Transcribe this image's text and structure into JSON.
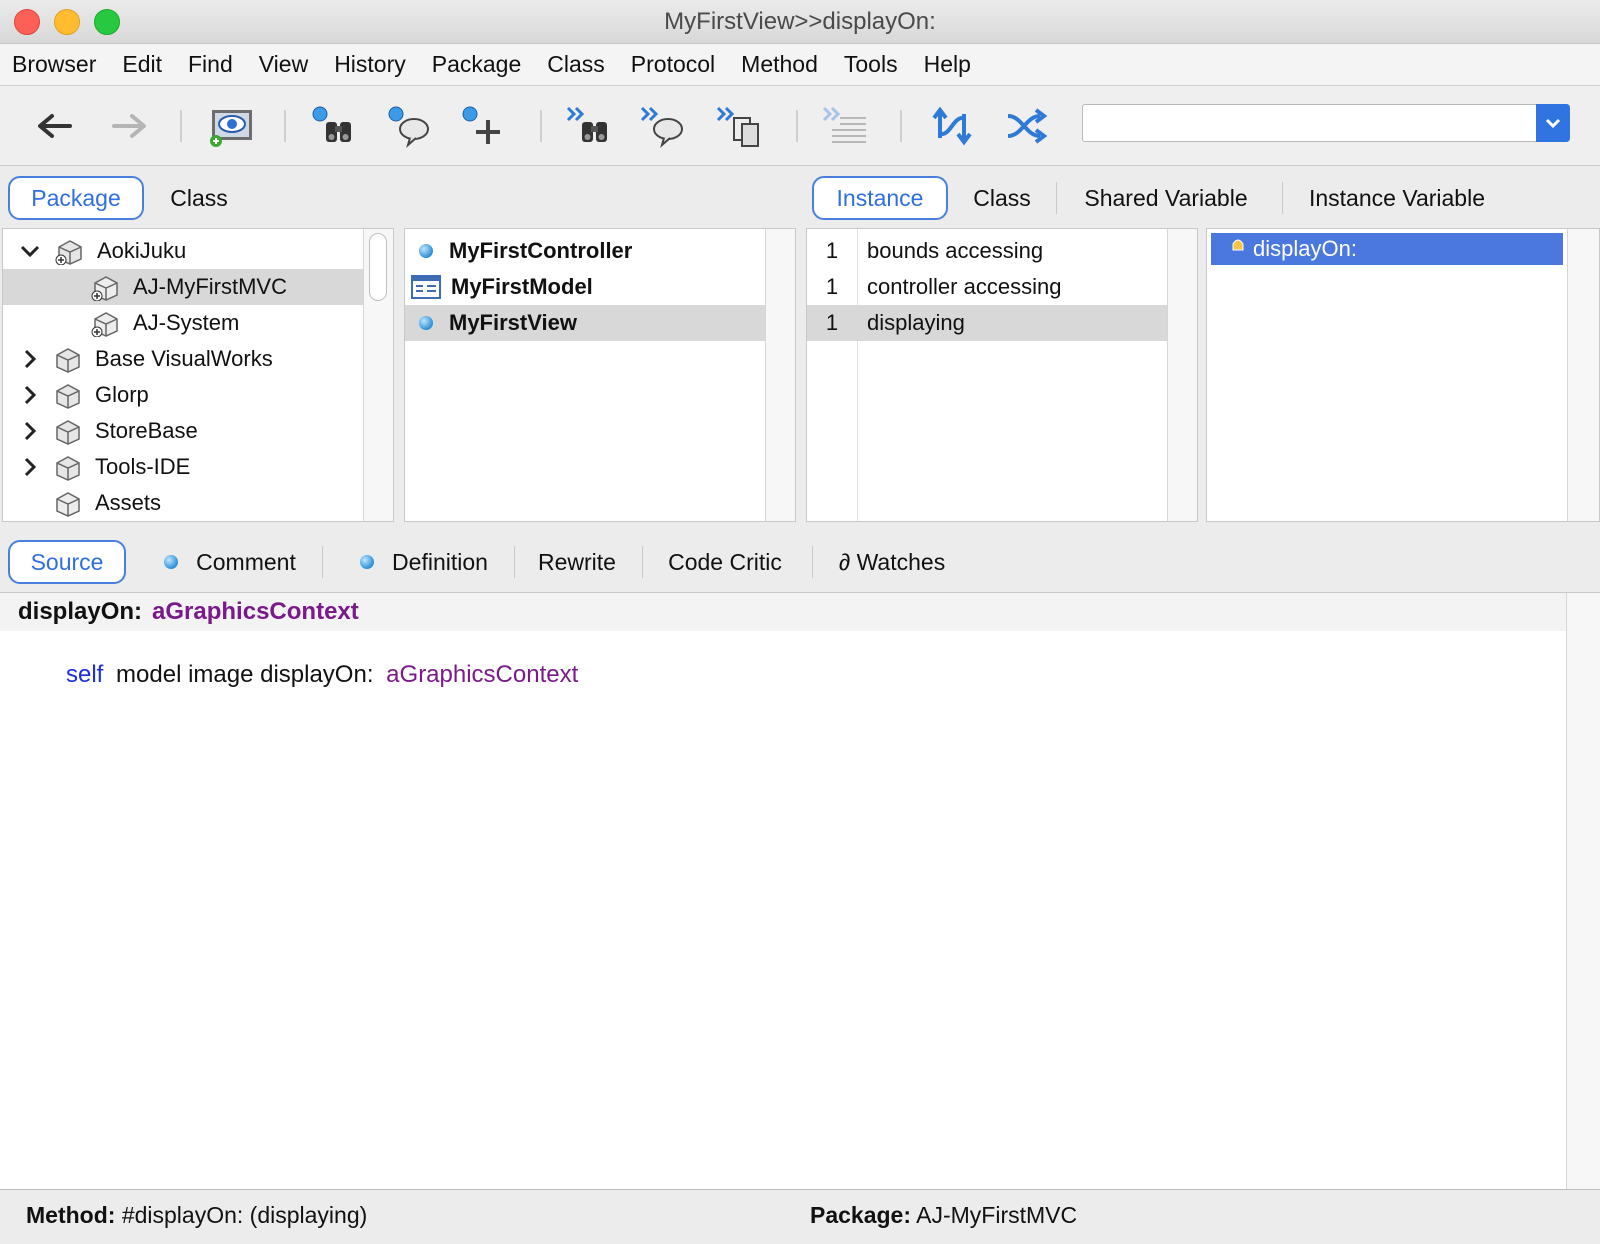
{
  "window": {
    "title": "MyFirstView>>displayOn:"
  },
  "menubar": {
    "items": [
      "Browser",
      "Edit",
      "Find",
      "View",
      "History",
      "Package",
      "Class",
      "Protocol",
      "Method",
      "Tools",
      "Help"
    ]
  },
  "toolbar": {
    "search": {
      "value": "",
      "placeholder": ""
    },
    "icons": [
      "back-arrow-icon",
      "forward-arrow-icon",
      "visual-launcher-icon",
      "find-class-binoculars-icon",
      "references-speech-icon",
      "add-class-icon",
      "senders-binoculars-icon",
      "implementors-speech-icon",
      "browse-copies-icon",
      "format-code-icon",
      "sync-icon",
      "shuffle-icon"
    ]
  },
  "navigator_tabs": {
    "left": [
      "Package",
      "Class"
    ],
    "left_active": "Package",
    "right": [
      "Instance",
      "Class",
      "Shared Variable",
      "Instance Variable"
    ],
    "right_active": "Instance"
  },
  "packages": [
    {
      "label": "AokiJuku",
      "expander": "open"
    },
    {
      "label": "AJ-MyFirstMVC",
      "expander": "none",
      "selected": true
    },
    {
      "label": "AJ-System",
      "expander": "none"
    },
    {
      "label": "Base VisualWorks",
      "expander": "closed"
    },
    {
      "label": "Glorp",
      "expander": "closed"
    },
    {
      "label": "StoreBase",
      "expander": "closed"
    },
    {
      "label": "Tools-IDE",
      "expander": "closed"
    },
    {
      "label": "Assets",
      "expander": "none"
    }
  ],
  "classes": [
    {
      "label": "MyFirstController",
      "icon": "class-dot-icon"
    },
    {
      "label": "MyFirstModel",
      "icon": "model-table-icon"
    },
    {
      "label": "MyFirstView",
      "icon": "class-dot-icon",
      "selected": true
    }
  ],
  "protocols": [
    {
      "count": "1",
      "label": "bounds accessing"
    },
    {
      "count": "1",
      "label": "controller accessing"
    },
    {
      "count": "1",
      "label": "displaying",
      "selected": true
    }
  ],
  "methods": [
    {
      "label": "displayOn:",
      "selected": true
    }
  ],
  "code_tabs": {
    "items": [
      "Source",
      "Comment",
      "Definition",
      "Rewrite",
      "Code Critic",
      "∂ Watches"
    ],
    "active": "Source"
  },
  "editor": {
    "signature_selector": "displayOn:",
    "signature_arg": "aGraphicsContext",
    "body_self": "self",
    "body_text": "model image displayOn:",
    "body_arg": "aGraphicsContext"
  },
  "statusbar": {
    "method_label": "Method:",
    "method_value": "#displayOn: (displaying)",
    "package_label": "Package:",
    "package_value": "AJ-MyFirstMVC"
  },
  "colors": {
    "accent": "#4a78de",
    "keyword": "#1c2fd8",
    "argument": "#7a1a8a"
  }
}
